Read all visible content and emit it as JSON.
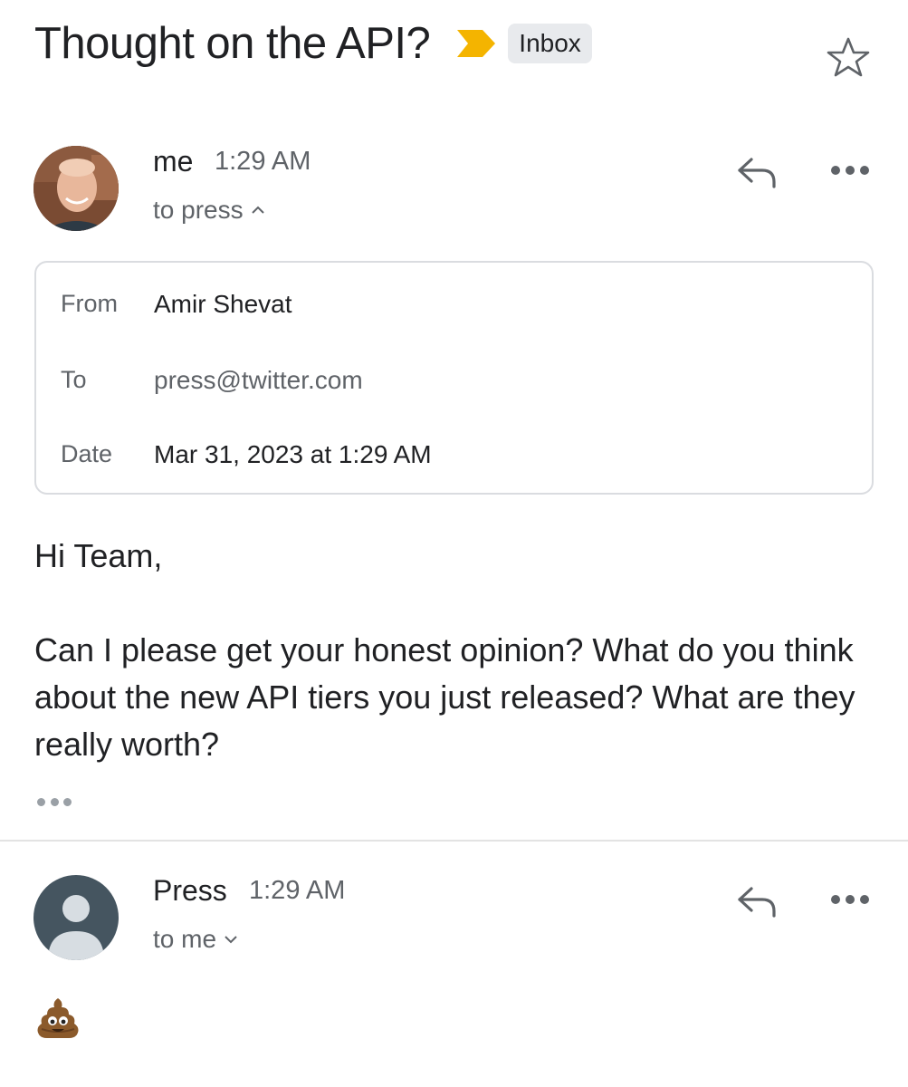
{
  "thread": {
    "subject": "Thought on the API?",
    "label": "Inbox",
    "importance_color": "#f4b400"
  },
  "messages": [
    {
      "sender": "me",
      "time": "1:29 AM",
      "recipient_summary": "to press",
      "details": {
        "from_label": "From",
        "from_name": "Amir Shevat",
        "to_label": "To",
        "to_value": "press@twitter.com",
        "date_label": "Date",
        "date_value": "Mar 31, 2023 at 1:29 AM"
      },
      "greeting": "Hi Team,",
      "body": "Can I please get your honest opinion? What do you think about the new API tiers you just released? What are they really worth?"
    },
    {
      "sender": "Press",
      "time": "1:29 AM",
      "recipient_summary": "to me",
      "body_emoji": "poop-emoji"
    }
  ],
  "colors": {
    "text_primary": "#202124",
    "text_secondary": "#5f6368",
    "chip_bg": "#e8eaed",
    "press_avatar": "#455560"
  }
}
